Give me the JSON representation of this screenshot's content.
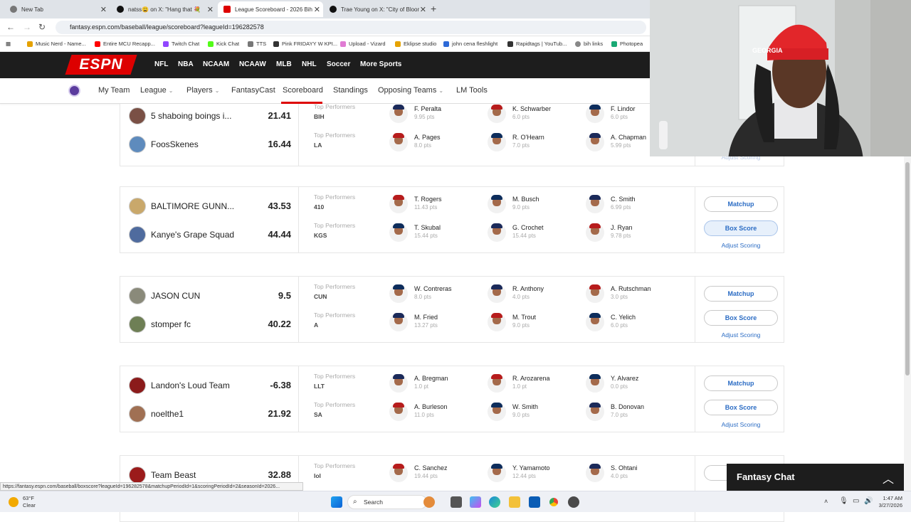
{
  "browser": {
    "tabs": [
      {
        "title": "New Tab",
        "color": "#555"
      },
      {
        "title": "natss😩 on X: \"Hang that 💐 ",
        "color": "#111"
      },
      {
        "title": "League Scoreboard - 2026 Bih",
        "color": "#d00"
      },
      {
        "title": "Trae Young on X: \"City of Bloom",
        "color": "#111"
      }
    ],
    "url": "fantasy.espn.com/baseball/league/scoreboard?leagueId=196282578",
    "bookmarks": [
      "Music Nerd - Name...",
      "Entire MCU Recapp...",
      "Twitch Chat",
      "Kick Chat",
      "TTS",
      "Pink FRIDAYY W KPI...",
      "Upload - Vizard",
      "Eklipse studio",
      "john cena fleshlight",
      "Rapidtags | YouTub...",
      "bih links",
      "Photopea"
    ],
    "status_url": "https://fantasy.espn.com/baseball/boxscore?leagueId=196282578&matchupPeriodId=1&scoringPeriodId=2&seasonId=2026..."
  },
  "espn": {
    "logo": "ESPN",
    "sports": [
      "NFL",
      "NBA",
      "NCAAM",
      "NCAAW",
      "MLB",
      "NHL",
      "Soccer",
      "More Sports"
    ],
    "subnav": [
      "My Team",
      "League",
      "Players",
      "FantasyCast",
      "Scoreboard",
      "Standings",
      "Opposing Teams",
      "LM Tools"
    ],
    "active_subnav": "Scoreboard"
  },
  "matchup_labels": {
    "top_performers": "Top Performers",
    "matchup": "Matchup",
    "box_score": "Box Score",
    "adjust_scoring": "Adjust Scoring"
  },
  "matchups": [
    {
      "teams": [
        {
          "name": "5 shaboing boings i...",
          "score": "21.41",
          "abbr": "BIH",
          "players": [
            {
              "name": "F. Peralta",
              "pts": "9.95 pts"
            },
            {
              "name": "K. Schwarber",
              "pts": "6.0 pts"
            },
            {
              "name": "F. Lindor",
              "pts": "6.0 pts"
            }
          ]
        },
        {
          "name": "FoosSkenes",
          "score": "16.44",
          "abbr": "LA",
          "players": [
            {
              "name": "A. Pages",
              "pts": "8.0 pts"
            },
            {
              "name": "R. O'Hearn",
              "pts": "7.0 pts"
            },
            {
              "name": "A. Chapman",
              "pts": "5.99 pts"
            }
          ]
        }
      ]
    },
    {
      "teams": [
        {
          "name": "BALTIMORE GUNN...",
          "score": "43.53",
          "abbr": "410",
          "players": [
            {
              "name": "T. Rogers",
              "pts": "11.43 pts"
            },
            {
              "name": "M. Busch",
              "pts": "9.0 pts"
            },
            {
              "name": "C. Smith",
              "pts": "6.99 pts"
            }
          ]
        },
        {
          "name": "Kanye's Grape Squad",
          "score": "44.44",
          "abbr": "KGS",
          "players": [
            {
              "name": "T. Skubal",
              "pts": "15.44 pts"
            },
            {
              "name": "G. Crochet",
              "pts": "15.44 pts"
            },
            {
              "name": "J. Ryan",
              "pts": "9.78 pts"
            }
          ]
        }
      ]
    },
    {
      "teams": [
        {
          "name": "JASON CUN",
          "score": "9.5",
          "abbr": "CUN",
          "players": [
            {
              "name": "W. Contreras",
              "pts": "8.0 pts"
            },
            {
              "name": "R. Anthony",
              "pts": "4.0 pts"
            },
            {
              "name": "A. Rutschman",
              "pts": "3.0 pts"
            }
          ]
        },
        {
          "name": "stomper fc",
          "score": "40.22",
          "abbr": "A",
          "players": [
            {
              "name": "M. Fried",
              "pts": "13.27 pts"
            },
            {
              "name": "M. Trout",
              "pts": "9.0 pts"
            },
            {
              "name": "C. Yelich",
              "pts": "6.0 pts"
            }
          ]
        }
      ]
    },
    {
      "teams": [
        {
          "name": "Landon's Loud Team",
          "score": "-6.38",
          "abbr": "LLT",
          "players": [
            {
              "name": "A. Bregman",
              "pts": "1.0 pt"
            },
            {
              "name": "R. Arozarena",
              "pts": "1.0 pt"
            },
            {
              "name": "Y. Alvarez",
              "pts": "0.0 pts"
            }
          ]
        },
        {
          "name": "noelthe1",
          "score": "21.92",
          "abbr": "SA",
          "players": [
            {
              "name": "A. Burleson",
              "pts": "11.0 pts"
            },
            {
              "name": "W. Smith",
              "pts": "9.0 pts"
            },
            {
              "name": "B. Donovan",
              "pts": "7.0 pts"
            }
          ]
        }
      ]
    },
    {
      "teams": [
        {
          "name": "Team Beast",
          "score": "32.88",
          "abbr": "lol",
          "players": [
            {
              "name": "C. Sanchez",
              "pts": "19.44 pts"
            },
            {
              "name": "Y. Yamamoto",
              "pts": "12.44 pts"
            },
            {
              "name": "S. Ohtani",
              "pts": "4.0 pts"
            }
          ]
        }
      ]
    }
  ],
  "chat": {
    "title": "Fantasy Chat"
  },
  "taskbar": {
    "weather_temp": "63°F",
    "weather_cond": "Clear",
    "search": "Search",
    "time": "1:47 AM",
    "date": "3/27/2026"
  },
  "colors": {
    "espn_red": "#d00",
    "link_blue": "#2b6cc4"
  }
}
